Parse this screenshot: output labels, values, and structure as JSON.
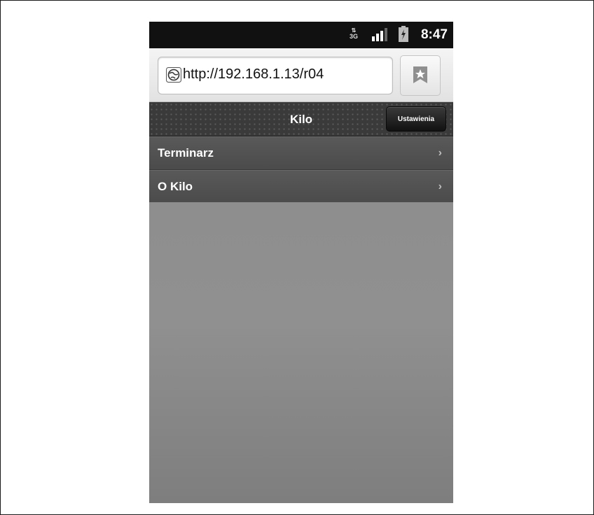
{
  "status_bar": {
    "network": "3G",
    "time": "8:47"
  },
  "browser": {
    "url": "http://192.168.1.13/r04",
    "bookmark_icon": "bookmark-star-icon"
  },
  "header": {
    "title": "Kilo",
    "settings_label": "Ustawienia"
  },
  "list": {
    "items": [
      {
        "label": "Terminarz"
      },
      {
        "label": "O Kilo"
      }
    ]
  }
}
